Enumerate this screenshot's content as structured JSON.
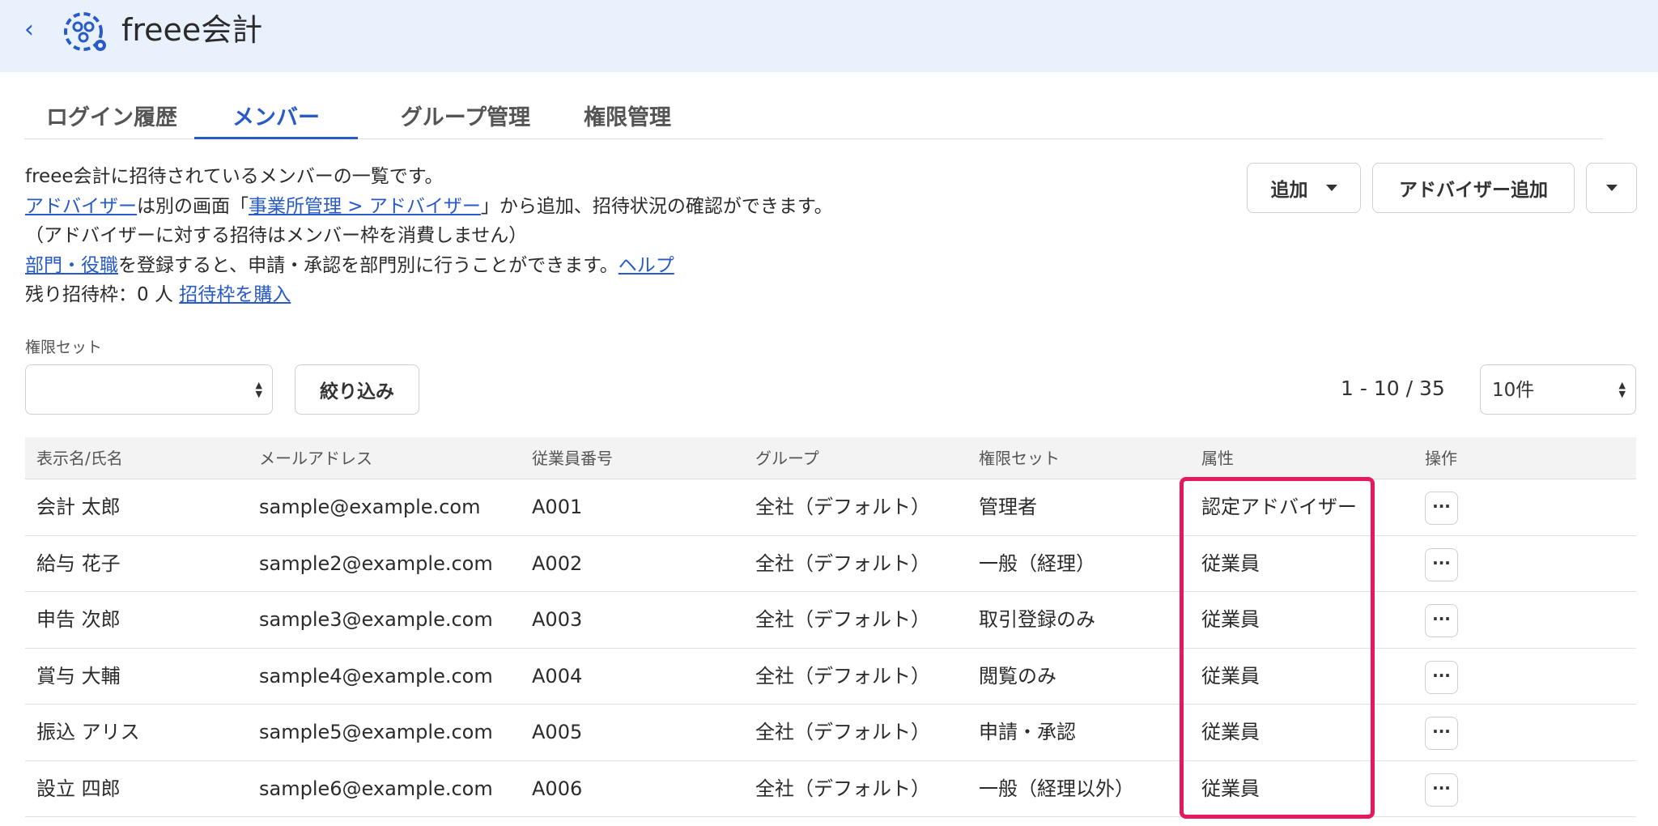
{
  "header": {
    "app_name": "freee会計",
    "back_icon": "chevron-left-icon",
    "logo_icon": "freee-apps-logo-icon"
  },
  "tabs": [
    {
      "label": "ログイン履歴",
      "active": false
    },
    {
      "label": "メンバー",
      "active": true
    },
    {
      "label": "グループ管理",
      "active": false
    },
    {
      "label": "権限管理",
      "active": false
    }
  ],
  "description": {
    "line1": "freee会計に招待されているメンバーの一覧です。",
    "line2_link1": "アドバイザー",
    "line2_text1": "は別の画面「",
    "line2_link2": "事業所管理 > アドバイザー",
    "line2_text2": "」から追加、招待状況の確認ができます。",
    "line3": "（アドバイザーに対する招待はメンバー枠を消費しません）",
    "line4_link1": "部門・役職",
    "line4_text1": "を登録すると、申請・承認を部門別に行うことができます。",
    "line4_link2": "ヘルプ",
    "line5_text": "残り招待枠：0 人 ",
    "line5_link": "招待枠を購入"
  },
  "actions": {
    "add_label": "追加",
    "add_advisor_label": "アドバイザー追加"
  },
  "filter": {
    "label": "権限セット",
    "selected": "",
    "button_label": "絞り込み"
  },
  "pager": {
    "range_text": "1 - 10 / 35",
    "per_page": "10件"
  },
  "table": {
    "headers": [
      "表示名/氏名",
      "メールアドレス",
      "従業員番号",
      "グループ",
      "権限セット",
      "属性",
      "操作"
    ],
    "rows": [
      {
        "name": "会計 太郎",
        "email": "sample@example.com",
        "emp_no": "A001",
        "group": "全社（デフォルト）",
        "perm": "管理者",
        "attr": "認定アドバイザー"
      },
      {
        "name": "給与 花子",
        "email": "sample2@example.com",
        "emp_no": "A002",
        "group": "全社（デフォルト）",
        "perm": "一般（経理）",
        "attr": "従業員"
      },
      {
        "name": "申告 次郎",
        "email": "sample3@example.com",
        "emp_no": "A003",
        "group": "全社（デフォルト）",
        "perm": "取引登録のみ",
        "attr": "従業員"
      },
      {
        "name": "賞与 大輔",
        "email": "sample4@example.com",
        "emp_no": "A004",
        "group": "全社（デフォルト）",
        "perm": "閲覧のみ",
        "attr": "従業員"
      },
      {
        "name": "振込 アリス",
        "email": "sample5@example.com",
        "emp_no": "A005",
        "group": "全社（デフォルト）",
        "perm": "申請・承認",
        "attr": "従業員"
      },
      {
        "name": "設立 四郎",
        "email": "sample6@example.com",
        "emp_no": "A006",
        "group": "全社（デフォルト）",
        "perm": "一般（経理以外）",
        "attr": "従業員"
      }
    ],
    "more_icon": "more-horizontal-icon"
  },
  "colors": {
    "accent": "#285ac8",
    "highlight": "#e8185c",
    "header_bg": "#e9f1fc"
  }
}
